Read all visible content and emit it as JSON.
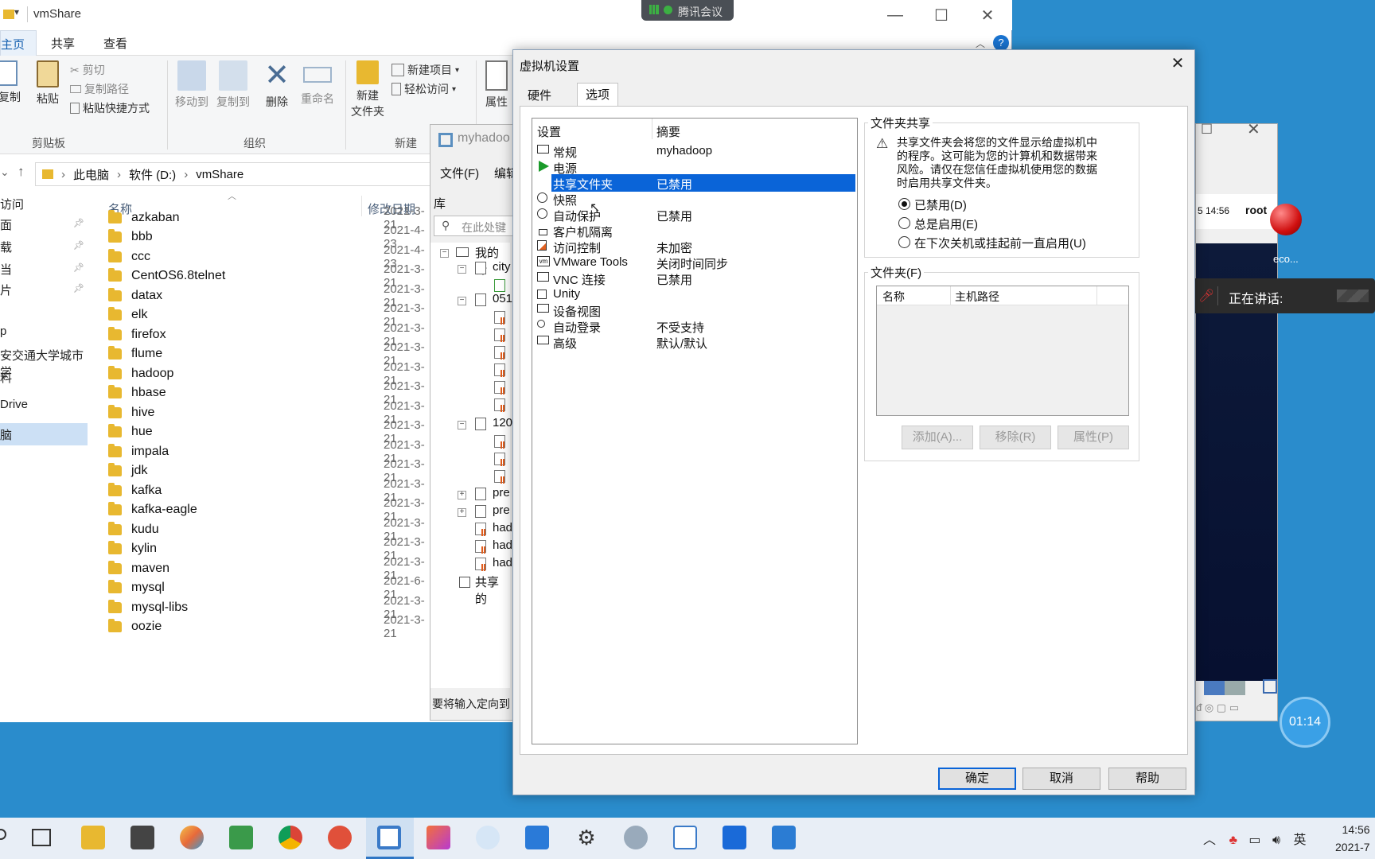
{
  "explorer": {
    "title": "vmShare",
    "tabs": [
      "主页",
      "共享",
      "查看"
    ],
    "ribbon": {
      "copy": "复制",
      "paste": "粘贴",
      "cut": "剪切",
      "copy_path": "复制路径",
      "paste_shortcut": "粘贴快捷方式",
      "clipboard": "剪贴板",
      "move_to": "移动到",
      "copy_to": "复制到",
      "delete": "删除",
      "rename": "重命名",
      "organize": "组织",
      "new_folder_1": "新建",
      "new_folder_2": "文件夹",
      "new_item": "新建项目",
      "easy_access": "轻松访问",
      "new": "新建",
      "properties": "属性"
    },
    "breadcrumb": [
      "此电脑",
      "软件 (D:)",
      "vmShare"
    ],
    "nav": [
      {
        "label": "访问",
        "pinned": false
      },
      {
        "label": "面",
        "pinned": true
      },
      {
        "label": "载",
        "pinned": true
      },
      {
        "label": "当",
        "pinned": true
      },
      {
        "label": "片",
        "pinned": true
      },
      {
        "label": "p",
        "pinned": false
      },
      {
        "label": "安交通大学城市学",
        "pinned": false
      },
      {
        "label": "料",
        "pinned": false
      },
      {
        "label": "Drive",
        "pinned": false
      },
      {
        "label": "脑",
        "pinned": false
      }
    ],
    "columns": {
      "name": "名称",
      "date": "修改日期"
    },
    "files": [
      {
        "name": "azkaban",
        "date": "2021-3-21"
      },
      {
        "name": "bbb",
        "date": "2021-4-23"
      },
      {
        "name": "ccc",
        "date": "2021-4-23"
      },
      {
        "name": "CentOS6.8telnet",
        "date": "2021-3-21"
      },
      {
        "name": "datax",
        "date": "2021-3-21"
      },
      {
        "name": "elk",
        "date": "2021-3-21"
      },
      {
        "name": "firefox",
        "date": "2021-3-21"
      },
      {
        "name": "flume",
        "date": "2021-3-21"
      },
      {
        "name": "hadoop",
        "date": "2021-3-21"
      },
      {
        "name": "hbase",
        "date": "2021-3-21"
      },
      {
        "name": "hive",
        "date": "2021-3-21"
      },
      {
        "name": "hue",
        "date": "2021-3-21"
      },
      {
        "name": "impala",
        "date": "2021-3-21"
      },
      {
        "name": "jdk",
        "date": "2021-3-21"
      },
      {
        "name": "kafka",
        "date": "2021-3-21"
      },
      {
        "name": "kafka-eagle",
        "date": "2021-3-21"
      },
      {
        "name": "kudu",
        "date": "2021-3-21"
      },
      {
        "name": "kylin",
        "date": "2021-3-21"
      },
      {
        "name": "maven",
        "date": "2021-3-21"
      },
      {
        "name": "mysql",
        "date": "2021-6-21"
      },
      {
        "name": "mysql-libs",
        "date": "2021-3-21"
      },
      {
        "name": "oozie",
        "date": "2021-3-21"
      }
    ]
  },
  "vmware": {
    "title": "myhadoo",
    "menu": [
      "文件(F)",
      "编辑"
    ],
    "library": "库",
    "search_placeholder": "在此处键",
    "tree": [
      "我的计",
      "city",
      "051",
      "120",
      "pre",
      "pre",
      "had",
      "had",
      "had",
      "共享的"
    ],
    "status": "要将输入定向到"
  },
  "dialog": {
    "title": "虚拟机设置",
    "tabs": [
      "硬件",
      "选项"
    ],
    "list_headers": {
      "setting": "设置",
      "summary": "摘要"
    },
    "settings": [
      {
        "name": "常规",
        "value": "myhadoop",
        "icon": "general-icon"
      },
      {
        "name": "电源",
        "value": "",
        "icon": "power-icon"
      },
      {
        "name": "共享文件夹",
        "value": "已禁用",
        "icon": "shared-folder-icon"
      },
      {
        "name": "快照",
        "value": "",
        "icon": "snapshot-icon"
      },
      {
        "name": "自动保护",
        "value": "已禁用",
        "icon": "autoprotect-icon"
      },
      {
        "name": "客户机隔离",
        "value": "",
        "icon": "lock-icon"
      },
      {
        "name": "访问控制",
        "value": "未加密",
        "icon": "access-control-icon"
      },
      {
        "name": "VMware Tools",
        "value": "关闭时间同步",
        "icon": "vmware-tools-icon"
      },
      {
        "name": "VNC 连接",
        "value": "已禁用",
        "icon": "vnc-icon"
      },
      {
        "name": "Unity",
        "value": "",
        "icon": "unity-icon"
      },
      {
        "name": "设备视图",
        "value": "",
        "icon": "device-view-icon"
      },
      {
        "name": "自动登录",
        "value": "不受支持",
        "icon": "autologin-icon"
      },
      {
        "name": "高级",
        "value": "默认/默认",
        "icon": "advanced-icon"
      }
    ],
    "sharing_group": "文件夹共享",
    "warning": [
      "共享文件夹会将您的文件显示给虚拟机中",
      "的程序。这可能为您的计算机和数据带来",
      "风险。请仅在您信任虚拟机使用您的数据",
      "时启用共享文件夹。"
    ],
    "radios": [
      {
        "label": "已禁用(D)",
        "checked": true
      },
      {
        "label": "总是启用(E)",
        "checked": false
      },
      {
        "label": "在下次关机或挂起前一直启用(U)",
        "checked": false
      }
    ],
    "folders_group": "文件夹(F)",
    "folder_columns": {
      "name": "名称",
      "host_path": "主机路径"
    },
    "folder_buttons": [
      "添加(A)...",
      "移除(R)",
      "属性(P)"
    ],
    "ok": "确定",
    "cancel": "取消",
    "help": "帮助"
  },
  "overlays": {
    "tencent_meeting": "腾讯会议",
    "speaking": "正在讲话:",
    "timer": "01:14",
    "vm_clock": "5 14:56",
    "vm_user": "root",
    "vm_icon_label": "eco..."
  },
  "taskbar": {
    "ime": "英",
    "time": "14:56",
    "date": "2021-7"
  }
}
